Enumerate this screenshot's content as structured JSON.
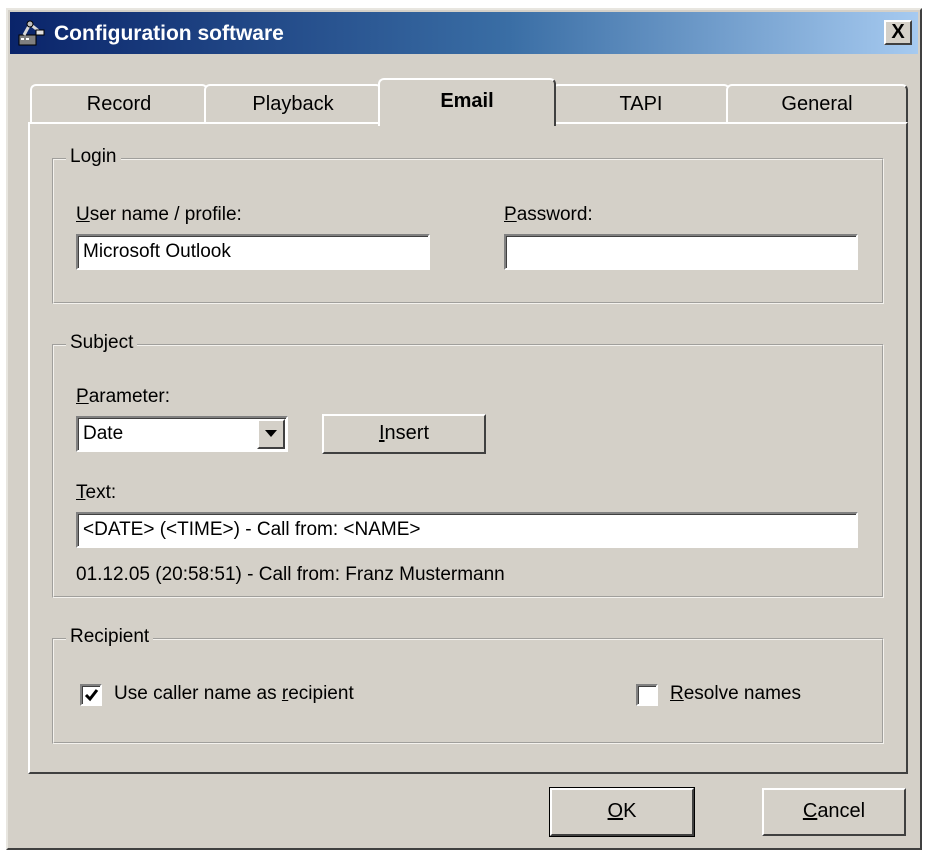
{
  "window": {
    "title": "Configuration software",
    "close_label": "X"
  },
  "tabs": [
    {
      "label": "Record",
      "active": false
    },
    {
      "label": "Playback",
      "active": false
    },
    {
      "label": "Email",
      "active": true
    },
    {
      "label": "TAPI",
      "active": false
    },
    {
      "label": "General",
      "active": false
    }
  ],
  "login": {
    "group_title": "Login",
    "username": {
      "label_first": "U",
      "label_rest": "ser name / profile:",
      "value": "Microsoft Outlook"
    },
    "password": {
      "label_first": "P",
      "label_rest": "assword:",
      "value": ""
    }
  },
  "subject": {
    "group_title": "Subject",
    "parameter": {
      "label_first": "P",
      "label_rest": "arameter:",
      "selected": "Date"
    },
    "insert_button": {
      "label_first": "I",
      "label_rest": "nsert"
    },
    "text": {
      "label_first": "T",
      "label_rest": "ext:",
      "value": "<DATE> (<TIME>) - Call from: <NAME>"
    },
    "preview": "01.12.05 (20:58:51) - Call from: Franz Mustermann"
  },
  "recipient": {
    "group_title": "Recipient",
    "use_caller": {
      "label_before": "Use caller name as ",
      "label_mnemonic": "r",
      "label_after": "ecipient",
      "checked": true
    },
    "resolve_names": {
      "label_first": "R",
      "label_rest": "esolve names",
      "checked": false
    }
  },
  "buttons": {
    "ok": {
      "label_first": "O",
      "label_rest": "K"
    },
    "cancel": {
      "label_first": "C",
      "label_rest": "ancel"
    }
  },
  "colors": {
    "dialog_bg": "#d4d0c8",
    "title_start": "#0a246a",
    "title_end": "#a6caf0"
  }
}
